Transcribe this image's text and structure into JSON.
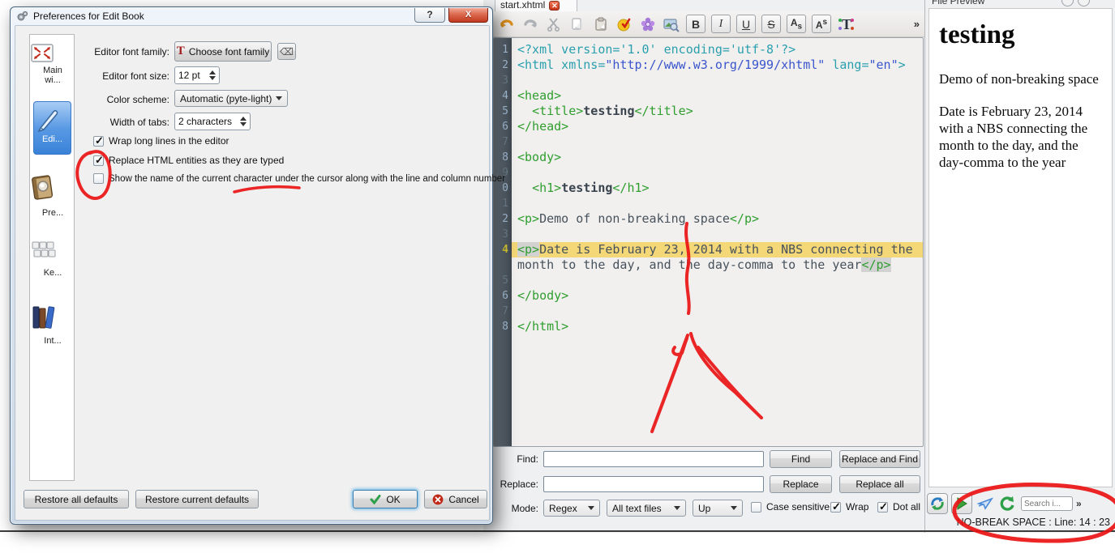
{
  "dialog": {
    "title": "Preferences for Edit Book",
    "help_button": "?",
    "close_button": "X",
    "sidebar_items": [
      {
        "label": "Main wi..."
      },
      {
        "label": "Edi..."
      },
      {
        "label": "Pre..."
      },
      {
        "label": "Ke..."
      },
      {
        "label": "Int..."
      }
    ],
    "fields": {
      "font_family_label": "Editor font family:",
      "choose_font_button": "Choose font family",
      "choose_font_icon_letter": "T",
      "clear_font_button": "⌫",
      "font_size_label": "Editor font size:",
      "font_size_value": "12 pt",
      "color_scheme_label": "Color scheme:",
      "color_scheme_value": "Automatic (pyte-light)",
      "tab_width_label": "Width of tabs:",
      "tab_width_value": "2 characters"
    },
    "checkboxes": [
      {
        "label": "Wrap long lines in the editor",
        "checked": true
      },
      {
        "label": "Replace HTML entities as they are typed",
        "checked": true
      },
      {
        "label": "Show the name of the current character under the cursor along with the line and column number",
        "checked": false
      }
    ],
    "buttons": {
      "restore_all": "Restore all defaults",
      "restore_current": "Restore current defaults",
      "ok": "OK",
      "cancel": "Cancel"
    }
  },
  "editor_area": {
    "tab_title": "start.xhtml",
    "toolbar_letter_buttons": {
      "bold": "B",
      "italic": "I",
      "underline": "U",
      "strike": "S",
      "sub_a": "A",
      "sub_s": "s",
      "sup_a": "A",
      "sup_s": "s",
      "overflow": "»"
    },
    "lines": [
      {
        "n": "1",
        "segs": [
          [
            "pi",
            "<?xml version='1.0' encoding='utf-8'?>"
          ]
        ]
      },
      {
        "n": "2",
        "segs": [
          [
            "pi",
            "<html xmlns="
          ],
          [
            "str",
            "\"http://www.w3.org/1999/xhtml\""
          ],
          [
            "pi",
            " lang="
          ],
          [
            "str",
            "\"en\""
          ],
          [
            "pi",
            ">"
          ]
        ]
      },
      {
        "n": "3",
        "dim": true,
        "segs": []
      },
      {
        "n": "4",
        "segs": [
          [
            "tag",
            "<head>"
          ]
        ]
      },
      {
        "n": "5",
        "segs": [
          [
            "pln",
            "  "
          ],
          [
            "tag",
            "<title>"
          ],
          [
            "b",
            "testing"
          ],
          [
            "tag",
            "</title>"
          ]
        ]
      },
      {
        "n": "6",
        "segs": [
          [
            "tag",
            "</head>"
          ]
        ]
      },
      {
        "n": "7",
        "dim": true,
        "segs": []
      },
      {
        "n": "8",
        "segs": [
          [
            "tag",
            "<body>"
          ]
        ]
      },
      {
        "n": "9",
        "dim": true,
        "segs": []
      },
      {
        "n": "0",
        "segs": [
          [
            "pln",
            "  "
          ],
          [
            "tag",
            "<h1>"
          ],
          [
            "b",
            "testing"
          ],
          [
            "tag",
            "</h1>"
          ]
        ]
      },
      {
        "n": "1",
        "dim": true,
        "segs": []
      },
      {
        "n": "2",
        "segs": [
          [
            "tag",
            "<p>"
          ],
          [
            "pln",
            "Demo of non-breaking space"
          ],
          [
            "tag",
            "</p>"
          ]
        ]
      },
      {
        "n": "3",
        "dim": true,
        "segs": []
      },
      {
        "n": "4",
        "cur": true,
        "hl": true,
        "segs": [
          [
            "tagm",
            "<p>"
          ],
          [
            "pln",
            "Date is February 23, 2014 with a NBS connecting the"
          ]
        ]
      },
      {
        "n": "",
        "segs": [
          [
            "pln",
            "month to the day, and the day-comma to the year"
          ],
          [
            "tagm",
            "</p>"
          ]
        ]
      },
      {
        "n": "5",
        "dim": true,
        "segs": []
      },
      {
        "n": "6",
        "segs": [
          [
            "tag",
            "</body>"
          ]
        ]
      },
      {
        "n": "7",
        "dim": true,
        "segs": []
      },
      {
        "n": "8",
        "segs": [
          [
            "tag",
            "</html>"
          ]
        ]
      }
    ]
  },
  "find_panel": {
    "find_label": "Find:",
    "replace_label": "Replace:",
    "mode_label": "Mode:",
    "find_value": "",
    "replace_value": "",
    "find_button": "Find",
    "replace_and_find_button": "Replace and Find",
    "replace_button": "Replace",
    "replace_all_button": "Replace all",
    "mode_value": "Regex",
    "files_value": "All text files",
    "direction_value": "Up",
    "case_sensitive_label": "Case sensitive",
    "case_sensitive_checked": false,
    "wrap_label": "Wrap",
    "wrap_checked": true,
    "dot_all_label": "Dot all",
    "dot_all_checked": true
  },
  "preview": {
    "panel_title": "File Preview",
    "heading": "testing",
    "para1": "Demo of non-breaking space",
    "para2": "Date is February 23, 2014 with a NBS connecting the month to the day, and the day-comma to the year",
    "search_placeholder": "Search i...",
    "overflow": "»",
    "status_text": "NO-BREAK SPACE : Line: 14 : 23"
  },
  "colors": {
    "annotation_red": "#ea1414",
    "current_line_highlight": "#f4d776",
    "tag_green": "#2f9e2f",
    "pi_teal": "#2a9fae",
    "string_blue": "#3a55cd",
    "selection_blue": "#3a82d8"
  }
}
